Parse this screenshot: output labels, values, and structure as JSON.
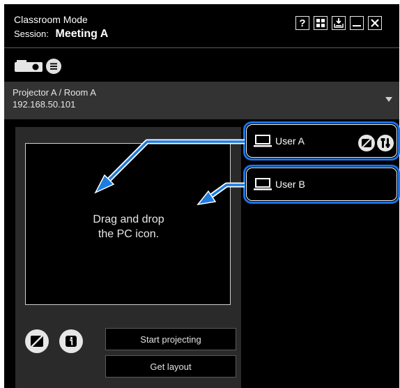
{
  "header": {
    "title": "Classroom Mode",
    "session_label": "Session:",
    "session_name": "Meeting A",
    "buttons": [
      "help-icon",
      "grid-icon",
      "download-icon",
      "minimize-icon",
      "close-icon"
    ]
  },
  "toolbar": {
    "icons": [
      "projector-icon",
      "list-icon"
    ]
  },
  "projector": {
    "name": "Projector A / Room A",
    "ip": "192.168.50.101"
  },
  "layout": {
    "drop_line1": "Drag and drop",
    "drop_line2": "the PC icon."
  },
  "actions": {
    "start_projecting": "Start projecting",
    "get_layout": "Get layout"
  },
  "users": [
    {
      "label": "User A"
    },
    {
      "label": "User B"
    }
  ],
  "colors": {
    "accent": "#1a73e8",
    "background": "#000000",
    "panel": "#2a2a2a",
    "dropdown": "#333333"
  }
}
